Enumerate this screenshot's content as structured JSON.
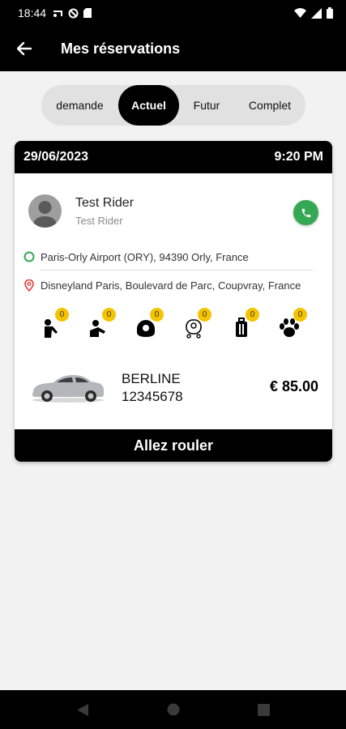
{
  "status_bar": {
    "time": "18:44"
  },
  "app_bar": {
    "title": "Mes réservations"
  },
  "tabs": [
    {
      "label": "demande",
      "active": false
    },
    {
      "label": "Actuel",
      "active": true
    },
    {
      "label": "Futur",
      "active": false
    },
    {
      "label": "Complet",
      "active": false
    }
  ],
  "booking": {
    "date": "29/06/2023",
    "time": "9:20 PM",
    "rider": {
      "name": "Test Rider",
      "subtitle": "Test Rider"
    },
    "pickup": "Paris-Orly Airport (ORY), 94390 Orly, France",
    "dropoff": "Disneyland Paris, Boulevard de Parc, Coupvray, France",
    "options": [
      {
        "icon": "child-seat-icon",
        "count": "0"
      },
      {
        "icon": "booster-seat-icon",
        "count": "0"
      },
      {
        "icon": "baby-carrier-icon",
        "count": "0"
      },
      {
        "icon": "pram-icon",
        "count": "0"
      },
      {
        "icon": "luggage-icon",
        "count": "0"
      },
      {
        "icon": "pet-paw-icon",
        "count": "0"
      }
    ],
    "vehicle": {
      "category": "BERLINE",
      "plate": "12345678"
    },
    "price": "€ 85.00",
    "action_label": "Allez rouler"
  },
  "colors": {
    "accent": "#000000",
    "call": "#34a853",
    "badge": "#f5c300",
    "pickup": "#34a853",
    "dropoff": "#e53935"
  }
}
